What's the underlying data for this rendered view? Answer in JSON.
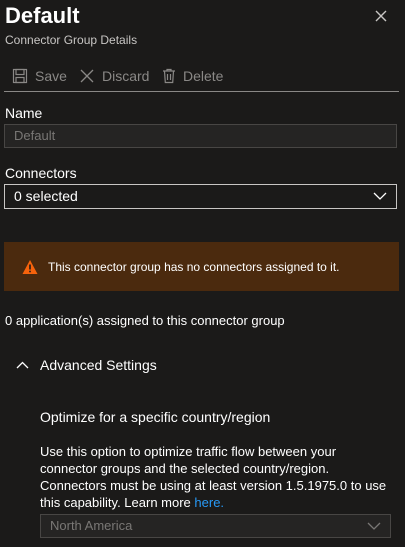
{
  "header": {
    "title": "Default",
    "subtitle": "Connector Group Details"
  },
  "toolbar": {
    "save_label": "Save",
    "discard_label": "Discard",
    "delete_label": "Delete"
  },
  "name_field": {
    "label": "Name",
    "value": "Default"
  },
  "connectors_field": {
    "label": "Connectors",
    "selected": "0 selected"
  },
  "warning": {
    "text": "This connector group has no connectors assigned to it."
  },
  "assigned_text": "0 application(s) assigned to this connector group",
  "advanced": {
    "label": "Advanced Settings",
    "optimize_title": "Optimize for a specific country/region",
    "description": "Use this option to optimize traffic flow between your connector groups and the selected country/region. Connectors must be using at least version 1.5.1975.0 to use this capability. Learn more",
    "link_text": "here.",
    "region_selected": "North America"
  },
  "colors": {
    "background": "#1b1a19",
    "text": "#ffffff",
    "muted": "#8a8886",
    "warning_bg": "#4b2a0e",
    "warning_icon": "#f7630c",
    "link": "#2899f5"
  }
}
